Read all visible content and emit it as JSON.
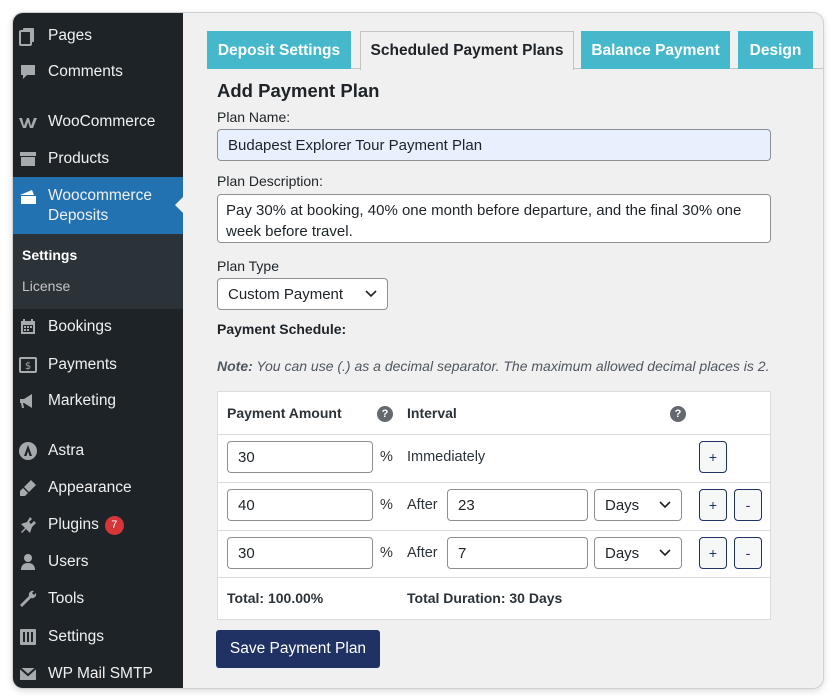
{
  "sidebar": {
    "items": [
      {
        "label": "Pages",
        "icon": "pages-icon"
      },
      {
        "label": "Comments",
        "icon": "comments-icon"
      },
      {
        "label": "WooCommerce",
        "icon": "woocommerce-icon"
      },
      {
        "label": "Products",
        "icon": "products-icon"
      },
      {
        "label": "Woocommerce Deposits",
        "icon": "deposits-icon"
      },
      {
        "label": "Bookings",
        "icon": "bookings-icon"
      },
      {
        "label": "Payments",
        "icon": "payments-icon"
      },
      {
        "label": "Marketing",
        "icon": "marketing-icon"
      },
      {
        "label": "Astra",
        "icon": "astra-icon"
      },
      {
        "label": "Appearance",
        "icon": "appearance-icon"
      },
      {
        "label": "Plugins",
        "icon": "plugins-icon",
        "badge": "7"
      },
      {
        "label": "Users",
        "icon": "users-icon"
      },
      {
        "label": "Tools",
        "icon": "tools-icon"
      },
      {
        "label": "Settings",
        "icon": "settings-icon"
      },
      {
        "label": "WP Mail SMTP",
        "icon": "mail-icon"
      }
    ],
    "submenu": [
      {
        "label": "Settings"
      },
      {
        "label": "License"
      }
    ]
  },
  "tabs": [
    {
      "label": "Deposit Settings"
    },
    {
      "label": "Scheduled Payment Plans"
    },
    {
      "label": "Balance Payment"
    },
    {
      "label": "Design"
    }
  ],
  "form": {
    "heading": "Add Payment Plan",
    "plan_name_label": "Plan Name:",
    "plan_name_value": "Budapest Explorer Tour Payment Plan",
    "plan_desc_label": "Plan Description:",
    "plan_desc_value": "Pay 30% at booking, 40% one month before departure, and the final 30% one week before travel.",
    "plan_type_label": "Plan Type",
    "plan_type_value": "Custom Payment",
    "schedule_label": "Payment Schedule:",
    "note_prefix": "Note:",
    "note_text": " You can use (.) as a decimal separator. The maximum allowed decimal places is 2."
  },
  "schedule": {
    "col_amount": "Payment Amount",
    "col_interval": "Interval",
    "help_glyph": "?",
    "percent_symbol": "%",
    "rows": [
      {
        "amount": "30",
        "interval_text": "Immediately"
      },
      {
        "amount": "40",
        "after_label": "After",
        "interval_value": "23",
        "unit": "Days"
      },
      {
        "amount": "30",
        "after_label": "After",
        "interval_value": "7",
        "unit": "Days"
      }
    ],
    "add_glyph": "+",
    "remove_glyph": "-",
    "total_label": "Total: 100.00%",
    "duration_label": "Total Duration: 30 Days"
  },
  "save_button": "Save Payment Plan",
  "colors": {
    "sidebar_bg": "#1d2327",
    "active_menu": "#2271b1",
    "tab_inactive": "#45b8cc",
    "primary_button": "#1f3263",
    "badge": "#d63638"
  }
}
